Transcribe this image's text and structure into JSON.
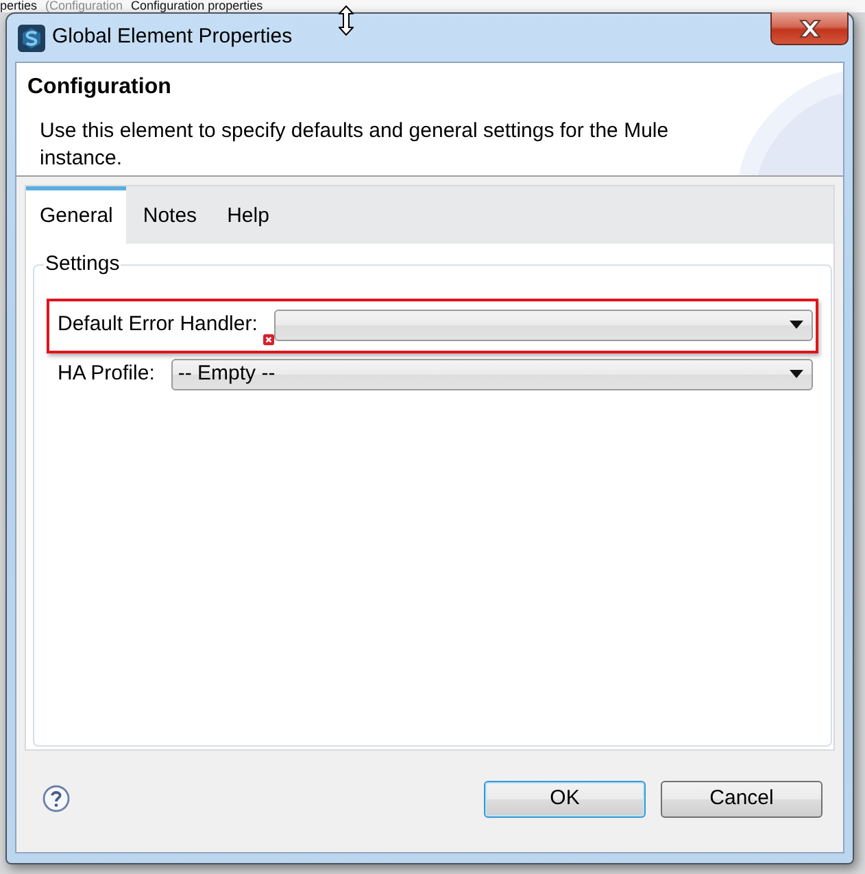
{
  "background": {
    "texts": [
      {
        "text": "perties",
        "dimmed": false
      },
      {
        "text": "(Configuration",
        "dimmed": true
      },
      {
        "text": "Configuration properties",
        "dimmed": false
      }
    ]
  },
  "window": {
    "title": "Global Element Properties"
  },
  "header": {
    "title": "Configuration",
    "description": "Use this element to specify defaults and general settings for the Mule instance."
  },
  "tabs": [
    {
      "label": "General",
      "selected": true
    },
    {
      "label": "Notes",
      "selected": false
    },
    {
      "label": "Help",
      "selected": false
    }
  ],
  "group": {
    "title": "Settings",
    "fields": [
      {
        "label": "Default Error Handler:",
        "error": true,
        "highlighted": true
      },
      {
        "label": "HA Profile:",
        "value": "-- Empty --",
        "error": false,
        "highlighted": false
      }
    ]
  },
  "buttons": [
    {
      "label": "OK",
      "default": true
    },
    {
      "label": "Cancel",
      "default": false
    }
  ]
}
